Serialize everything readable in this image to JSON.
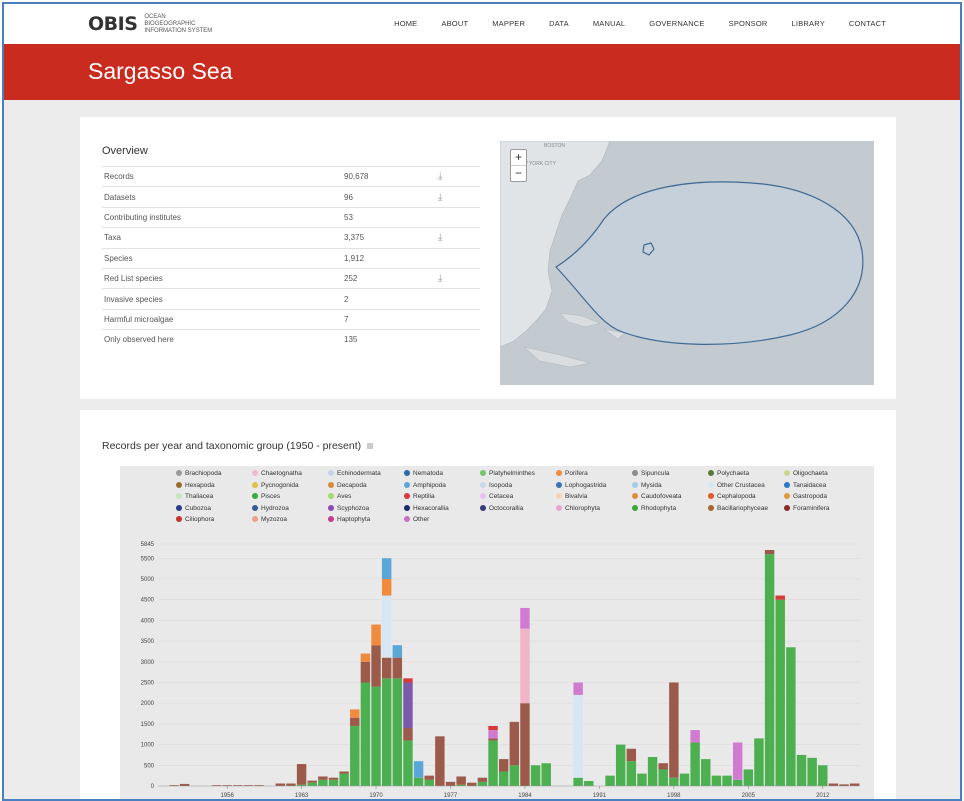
{
  "logo": {
    "mark": "OBIS",
    "sub": "Ocean Biogeographic Information System"
  },
  "nav": [
    "HOME",
    "ABOUT",
    "MAPPER",
    "DATA",
    "MANUAL",
    "GOVERNANCE",
    "SPONSOR",
    "LIBRARY",
    "CONTACT"
  ],
  "page_title": "Sargasso Sea",
  "overview": {
    "title": "Overview",
    "rows": [
      {
        "label": "Records",
        "value": "90,678",
        "download": true
      },
      {
        "label": "Datasets",
        "value": "96",
        "download": true
      },
      {
        "label": "Contributing institutes",
        "value": "53",
        "download": false
      },
      {
        "label": "Taxa",
        "value": "3,375",
        "download": true
      },
      {
        "label": "Species",
        "value": "1,912",
        "download": false
      },
      {
        "label": "Red List species",
        "value": "252",
        "download": true
      },
      {
        "label": "Invasive species",
        "value": "2",
        "download": false
      },
      {
        "label": "Harmful microalgae",
        "value": "7",
        "download": false
      },
      {
        "label": "Only observed here",
        "value": "135",
        "download": false
      }
    ],
    "download_glyph": "⤓"
  },
  "map": {
    "zoom_in": "+",
    "zoom_out": "−",
    "labels": [
      "BOSTON",
      "NEW YORK CITY"
    ],
    "area_fill": "#c6d0da",
    "area_stroke": "#3f6a94"
  },
  "chart_title": "Records per year and taxonomic group (1950 - present)",
  "legend": [
    {
      "name": "Brachiopoda",
      "color": "#999999"
    },
    {
      "name": "Chaetognatha",
      "color": "#f2b6d2"
    },
    {
      "name": "Echinodermata",
      "color": "#c7d5e8"
    },
    {
      "name": "Nematoda",
      "color": "#2b6aa6"
    },
    {
      "name": "Platyhelminthes",
      "color": "#6fc96a"
    },
    {
      "name": "Porifera",
      "color": "#f08a3c"
    },
    {
      "name": "Sipuncula",
      "color": "#8c8c8c"
    },
    {
      "name": "Polychaeta",
      "color": "#5a7a3a"
    },
    {
      "name": "Oligochaeta",
      "color": "#c8d88a"
    },
    {
      "name": "Hexapoda",
      "color": "#9a6b2f"
    },
    {
      "name": "Pycnogonida",
      "color": "#e0c24a"
    },
    {
      "name": "Decapoda",
      "color": "#d98a3a"
    },
    {
      "name": "Amphipoda",
      "color": "#5aa6d6"
    },
    {
      "name": "Isopoda",
      "color": "#c9d9ef"
    },
    {
      "name": "Lophogastrida",
      "color": "#3a74b8"
    },
    {
      "name": "Mysida",
      "color": "#9ecde8"
    },
    {
      "name": "Other Crustacea",
      "color": "#d6e6f3"
    },
    {
      "name": "Tanaidacea",
      "color": "#2a78c8"
    },
    {
      "name": "Thaliacea",
      "color": "#c8e6c0"
    },
    {
      "name": "Pisces",
      "color": "#3aa83a"
    },
    {
      "name": "Aves",
      "color": "#a6d96a"
    },
    {
      "name": "Reptilia",
      "color": "#d63a3a"
    },
    {
      "name": "Cetacea",
      "color": "#e6c2ea"
    },
    {
      "name": "Bivalvia",
      "color": "#f3d6b8"
    },
    {
      "name": "Caudofoveata",
      "color": "#e08a3a"
    },
    {
      "name": "Cephalopoda",
      "color": "#e05a2a"
    },
    {
      "name": "Gastropoda",
      "color": "#e6983a"
    },
    {
      "name": "Cubozoa",
      "color": "#2a3a8a"
    },
    {
      "name": "Hydrozoa",
      "color": "#3a5a9a"
    },
    {
      "name": "Scyphozoa",
      "color": "#8a4ab8"
    },
    {
      "name": "Hexacorallia",
      "color": "#1a2a6a"
    },
    {
      "name": "Octocorallia",
      "color": "#3a3a7a"
    },
    {
      "name": "Chlorophyta",
      "color": "#e8a6d2"
    },
    {
      "name": "Rhodophyta",
      "color": "#3aa83a"
    },
    {
      "name": "Bacillariophyceae",
      "color": "#a8682a"
    },
    {
      "name": "Foraminifera",
      "color": "#8a2a2a"
    },
    {
      "name": "Ciliophora",
      "color": "#c8302a"
    },
    {
      "name": "Myzozoa",
      "color": "#f0a08a"
    },
    {
      "name": "Haptophyta",
      "color": "#c83a8a"
    },
    {
      "name": "Other",
      "color": "#c870c8"
    }
  ],
  "chart_data": {
    "type": "bar",
    "stacked": true,
    "title": "Records per year and taxonomic group (1950 - present)",
    "xlabel": "",
    "ylabel": "",
    "ylim": [
      0,
      5845
    ],
    "y_ticks": [
      0,
      500,
      1000,
      1500,
      2000,
      2500,
      3000,
      3500,
      4000,
      4500,
      5000,
      5500,
      5845
    ],
    "x_ticks": [
      "1956",
      "1963",
      "1970",
      "1977",
      "1984",
      "1991",
      "1998",
      "2005",
      "2012"
    ],
    "years": [
      1950,
      1951,
      1952,
      1953,
      1954,
      1955,
      1956,
      1957,
      1958,
      1959,
      1960,
      1961,
      1962,
      1963,
      1964,
      1965,
      1966,
      1967,
      1968,
      1969,
      1970,
      1971,
      1972,
      1973,
      1974,
      1975,
      1976,
      1977,
      1978,
      1979,
      1980,
      1981,
      1982,
      1983,
      1984,
      1985,
      1986,
      1987,
      1988,
      1989,
      1990,
      1991,
      1992,
      1993,
      1994,
      1995,
      1996,
      1997,
      1998,
      1999,
      2000,
      2001,
      2002,
      2003,
      2004,
      2005,
      2006,
      2007,
      2008,
      2009,
      2010,
      2011,
      2012,
      2013,
      2014,
      2015
    ],
    "series": [
      {
        "name": "Pisces",
        "color": "#4caf50",
        "values": [
          0,
          0,
          0,
          0,
          0,
          0,
          0,
          0,
          0,
          0,
          0,
          0,
          0,
          30,
          80,
          150,
          150,
          300,
          1450,
          2500,
          2400,
          2600,
          2600,
          1100,
          200,
          150,
          0,
          0,
          30,
          0,
          100,
          1100,
          350,
          500,
          0,
          500,
          550,
          0,
          0,
          200,
          120,
          0,
          250,
          1000,
          600,
          300,
          700,
          400,
          200,
          300,
          1050,
          650,
          250,
          250,
          150,
          400,
          1150,
          5600,
          4500,
          3350,
          750,
          680,
          500,
          0,
          0,
          0
        ]
      },
      {
        "name": "Bacillariophyceae",
        "color": "#9b5a4a",
        "values": [
          0,
          20,
          50,
          0,
          0,
          20,
          20,
          20,
          20,
          20,
          0,
          60,
          60,
          500,
          50,
          80,
          50,
          50,
          200,
          500,
          1000,
          500,
          500,
          300,
          0,
          100,
          1200,
          100,
          200,
          80,
          100,
          50,
          300,
          1050,
          2000,
          0,
          0,
          0,
          0,
          0,
          0,
          0,
          0,
          0,
          300,
          0,
          0,
          150,
          2300,
          0,
          0,
          0,
          0,
          0,
          0,
          0,
          0,
          100,
          0,
          0,
          0,
          0,
          0,
          60,
          40,
          60
        ]
      },
      {
        "name": "Chaetognatha",
        "color": "#f0b6c8",
        "values": [
          0,
          0,
          0,
          0,
          0,
          0,
          0,
          0,
          0,
          0,
          0,
          0,
          0,
          0,
          0,
          0,
          0,
          0,
          0,
          0,
          0,
          0,
          0,
          0,
          0,
          0,
          0,
          0,
          0,
          0,
          0,
          0,
          0,
          0,
          1800,
          0,
          0,
          0,
          0,
          0,
          0,
          0,
          0,
          0,
          0,
          0,
          0,
          0,
          0,
          0,
          0,
          0,
          0,
          0,
          0,
          0,
          0,
          0,
          0,
          0,
          0,
          0,
          0,
          0,
          0,
          0
        ]
      },
      {
        "name": "Other Crustacea",
        "color": "#d6e6f3",
        "values": [
          0,
          0,
          0,
          0,
          0,
          0,
          0,
          0,
          0,
          0,
          0,
          0,
          0,
          0,
          0,
          0,
          0,
          0,
          0,
          0,
          0,
          1500,
          0,
          0,
          0,
          0,
          0,
          0,
          0,
          0,
          0,
          0,
          0,
          0,
          0,
          0,
          0,
          0,
          0,
          2000,
          0,
          0,
          0,
          0,
          0,
          0,
          0,
          0,
          0,
          0,
          0,
          0,
          0,
          0,
          0,
          0,
          0,
          0,
          0,
          0,
          0,
          0,
          0,
          0,
          0,
          0
        ]
      },
      {
        "name": "Other",
        "color": "#d07ad0",
        "values": [
          0,
          0,
          0,
          0,
          0,
          0,
          0,
          0,
          0,
          0,
          0,
          0,
          0,
          0,
          0,
          0,
          0,
          0,
          0,
          0,
          0,
          0,
          0,
          0,
          0,
          0,
          0,
          0,
          0,
          0,
          0,
          200,
          0,
          0,
          500,
          0,
          0,
          0,
          0,
          300,
          0,
          0,
          0,
          0,
          0,
          0,
          0,
          0,
          0,
          0,
          300,
          0,
          0,
          0,
          900,
          0,
          0,
          0,
          0,
          0,
          0,
          0,
          0,
          0,
          0,
          0
        ]
      },
      {
        "name": "Porifera",
        "color": "#f08a3c",
        "values": [
          0,
          0,
          0,
          0,
          0,
          0,
          0,
          0,
          0,
          0,
          0,
          0,
          0,
          0,
          0,
          0,
          0,
          0,
          200,
          200,
          500,
          400,
          0,
          0,
          0,
          0,
          0,
          0,
          0,
          0,
          0,
          0,
          0,
          0,
          0,
          0,
          0,
          0,
          0,
          0,
          0,
          0,
          0,
          0,
          0,
          0,
          0,
          0,
          0,
          0,
          0,
          0,
          0,
          0,
          0,
          0,
          0,
          0,
          0,
          0,
          0,
          0,
          0,
          0,
          0,
          0
        ]
      },
      {
        "name": "Scyphozoa",
        "color": "#7d5aa8",
        "values": [
          0,
          0,
          0,
          0,
          0,
          0,
          0,
          0,
          0,
          0,
          0,
          0,
          0,
          0,
          0,
          0,
          0,
          0,
          0,
          0,
          0,
          0,
          0,
          1100,
          0,
          0,
          0,
          0,
          0,
          0,
          0,
          0,
          0,
          0,
          0,
          0,
          0,
          0,
          0,
          0,
          0,
          0,
          0,
          0,
          0,
          0,
          0,
          0,
          0,
          0,
          0,
          0,
          0,
          0,
          0,
          0,
          0,
          0,
          0,
          0,
          0,
          0,
          0,
          0,
          0,
          0
        ]
      },
      {
        "name": "Reptilia",
        "color": "#d63a3a",
        "values": [
          0,
          0,
          0,
          0,
          0,
          0,
          0,
          0,
          0,
          0,
          0,
          0,
          0,
          0,
          0,
          0,
          0,
          0,
          0,
          0,
          0,
          0,
          0,
          100,
          0,
          0,
          0,
          0,
          0,
          0,
          0,
          100,
          0,
          0,
          0,
          0,
          0,
          0,
          0,
          0,
          0,
          0,
          0,
          0,
          0,
          0,
          0,
          0,
          0,
          0,
          0,
          0,
          0,
          0,
          0,
          0,
          0,
          0,
          100,
          0,
          0,
          0,
          0,
          0,
          0,
          0
        ]
      },
      {
        "name": "Amphipoda",
        "color": "#5aa6d6",
        "values": [
          0,
          0,
          0,
          0,
          0,
          0,
          0,
          0,
          0,
          0,
          0,
          0,
          0,
          0,
          0,
          0,
          0,
          0,
          0,
          0,
          0,
          500,
          300,
          0,
          400,
          0,
          0,
          0,
          0,
          0,
          0,
          0,
          0,
          0,
          0,
          0,
          0,
          0,
          0,
          0,
          0,
          0,
          0,
          0,
          0,
          0,
          0,
          0,
          0,
          0,
          0,
          0,
          0,
          0,
          0,
          0,
          0,
          0,
          0,
          0,
          0,
          0,
          0,
          0,
          0,
          0
        ]
      }
    ]
  }
}
